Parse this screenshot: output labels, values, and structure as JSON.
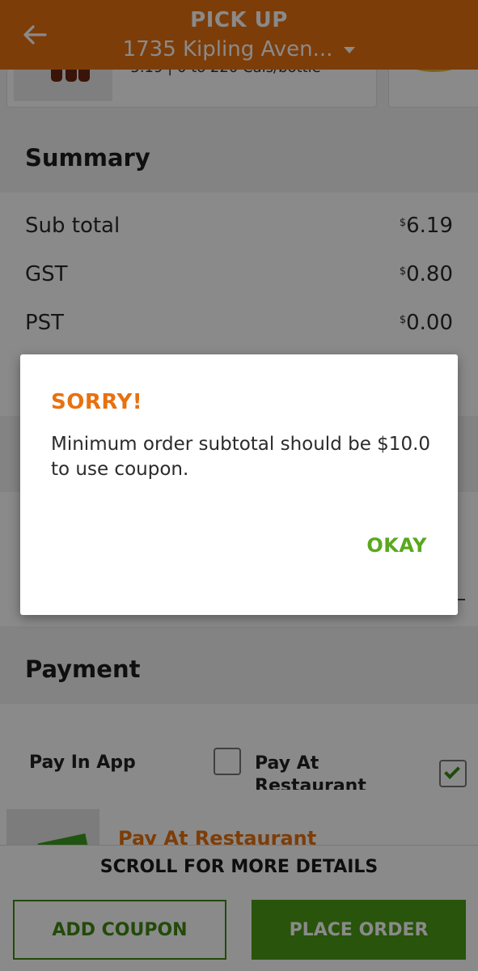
{
  "header": {
    "title": "PICK UP",
    "address": "1735 Kipling Aven..."
  },
  "product": {
    "price_currency": "$",
    "price_and_cals": "5.19 | 0 to 220 Cals/bottle"
  },
  "summary": {
    "title": "Summary",
    "rows": [
      {
        "label": "Sub total",
        "currency": "$",
        "amount": "6.19"
      },
      {
        "label": "GST",
        "currency": "$",
        "amount": "0.80"
      },
      {
        "label": "PST",
        "currency": "$",
        "amount": "0.00"
      }
    ]
  },
  "payment": {
    "title": "Payment",
    "options": [
      {
        "label": "Pay In App",
        "checked": false
      },
      {
        "label": "Pay At Restaurant",
        "checked": true
      }
    ],
    "selected_label": "Pay At Restaurant"
  },
  "bottom_bar": {
    "scroll_hint": "SCROLL FOR MORE DETAILS",
    "add_coupon": "ADD COUPON",
    "place_order": "PLACE ORDER"
  },
  "dialog": {
    "title": "SORRY!",
    "message": "Minimum order subtotal should be $10.0 to use coupon.",
    "ok_label": "OKAY"
  },
  "colors": {
    "brand_orange": "#e8710f",
    "action_green": "#4a9b16",
    "ok_green": "#5aa81e"
  }
}
